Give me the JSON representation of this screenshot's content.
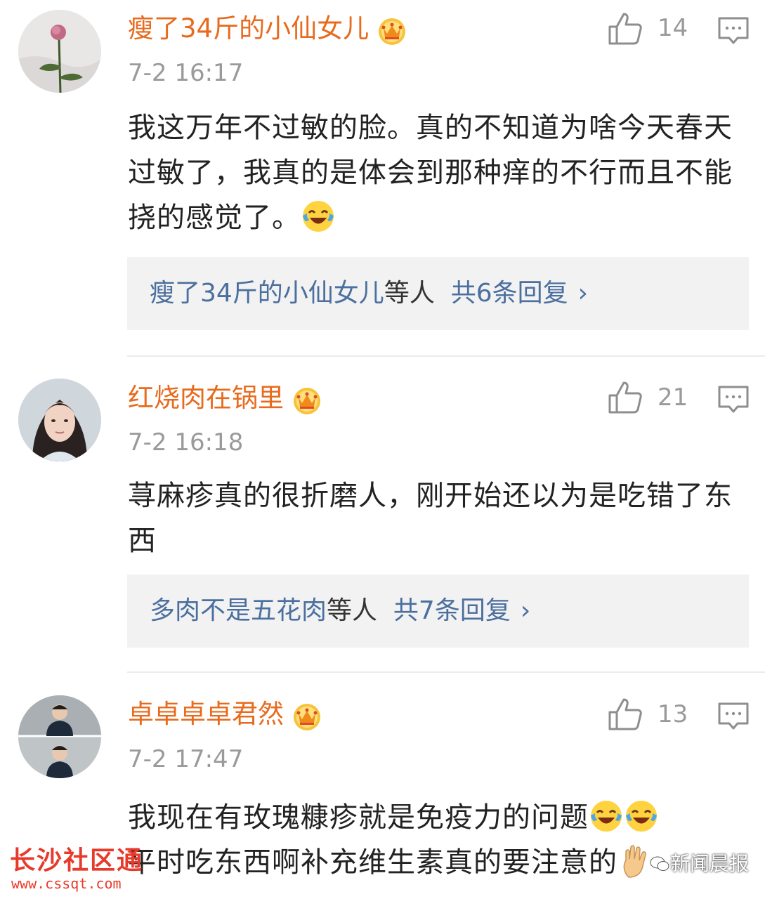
{
  "comments": [
    {
      "username": "瘦了34斤的小仙女儿",
      "timestamp": "7-2 16:17",
      "likes": "14",
      "text_parts": [
        "我这万年不过敏的脸。真的不知道为啥今天春天过敏了，我真的是体会到那种痒的不行而且不能挠的感觉了。"
      ],
      "emoji_icons": [
        "laugh-cry-emoji"
      ],
      "replies_user": "瘦了34斤的小仙女儿",
      "replies_suffix": "等人",
      "replies_count": "共6条回复",
      "avatar_icon": "rose-avatar"
    },
    {
      "username": "红烧肉在锅里",
      "timestamp": "7-2 16:18",
      "likes": "21",
      "text_parts": [
        "荨麻疹真的很折磨人，刚开始还以为是吃错了东西"
      ],
      "replies_user": "多肉不是五花肉",
      "replies_suffix": "等人",
      "replies_count": "共7条回复",
      "avatar_icon": "woman-portrait-avatar"
    },
    {
      "username": "卓卓卓卓君然",
      "timestamp": "7-2 17:47",
      "likes": "13",
      "text_line1": "我现在有玫瑰糠疹就是免疫力的问题",
      "text_line2": "平时吃东西啊补充维生素真的要注意的",
      "emoji_icons": [
        "laugh-cry-emoji",
        "laugh-cry-emoji",
        "ok-hand-emoji"
      ],
      "avatar_icon": "man-portrait-avatar"
    }
  ],
  "watermarks": {
    "left_text": "长沙社区通",
    "left_url": "www.cssqt.com",
    "right_text": "新闻晨报"
  },
  "colors": {
    "username": "#e86a1c",
    "timestamp": "#9a9a9a",
    "reply_link": "#4b6f9e",
    "reply_bg": "#f2f2f2"
  }
}
